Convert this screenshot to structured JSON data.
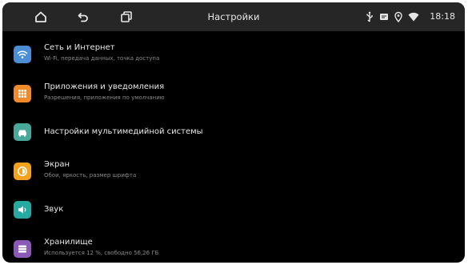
{
  "topbar": {
    "title": "Настройки",
    "time": "18:18",
    "nav_icons": [
      "home-icon",
      "back-icon",
      "recent-apps-icon"
    ],
    "status_icons": [
      "usb-icon",
      "notification-icon",
      "location-icon",
      "wifi-icon"
    ]
  },
  "settings": [
    {
      "title": "Сеть и Интернет",
      "subtitle": "Wi-Fi, передача данных, точка доступа",
      "icon": "wifi-icon",
      "color": "#4a8fd6"
    },
    {
      "title": "Приложения и уведомления",
      "subtitle": "Разрешения, приложения по умолчанию",
      "icon": "apps-icon",
      "color": "#f08a2a"
    },
    {
      "title": "Настройки мультимедийной системы",
      "subtitle": "",
      "icon": "car-icon",
      "color": "#4aa89a"
    },
    {
      "title": "Экран",
      "subtitle": "Обои, яркость, размер шрифта",
      "icon": "brightness-icon",
      "color": "#f2a21c"
    },
    {
      "title": "Звук",
      "subtitle": "",
      "icon": "volume-icon",
      "color": "#25a9a0"
    },
    {
      "title": "Хранилище",
      "subtitle": "Используется 12 %, свободно 56,26 ГБ",
      "icon": "storage-icon",
      "color": "#8b5ab6"
    }
  ]
}
